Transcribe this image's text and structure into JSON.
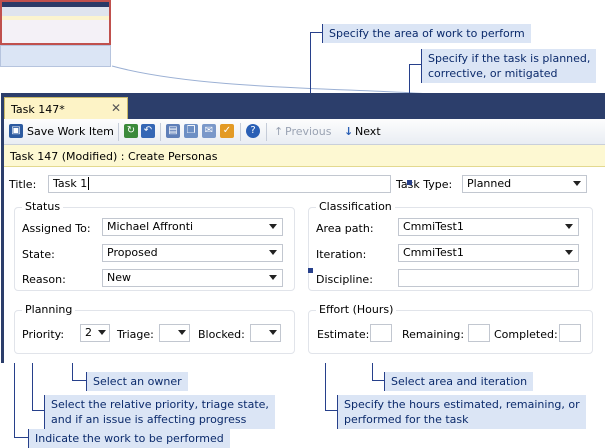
{
  "callouts": {
    "area_of_work": "Specify the area of work to perform",
    "task_type_1": "Specify if the task is planned,",
    "task_type_2": "corrective, or mitigated",
    "select_owner": "Select an owner",
    "priority_1": "Select the relative priority, triage state,",
    "priority_2": "and if an issue is affecting progress",
    "work_to_perform": "Indicate the work to be performed",
    "area_iteration": "Select area and iteration",
    "hours_1": "Specify the hours estimated, remaining, or",
    "hours_2": "performed for the task"
  },
  "tab": {
    "label": "Task 147*",
    "close": "✕"
  },
  "toolbar": {
    "save_label": "Save Work Item",
    "previous_label": "Previous",
    "next_label": "Next",
    "previous_arrow": "↑",
    "next_arrow": "↓"
  },
  "infobar": {
    "text": "Task 147 (Modified) : Create Personas"
  },
  "form": {
    "title_label": "Title:",
    "title_value": "Task 1",
    "task_type_label": "Task Type:",
    "task_type_value": "Planned",
    "status": {
      "heading": "Status",
      "assigned_label": "Assigned To:",
      "assigned_value": "Michael Affronti",
      "state_label": "State:",
      "state_value": "Proposed",
      "reason_label": "Reason:",
      "reason_value": "New"
    },
    "classification": {
      "heading": "Classification",
      "area_label": "Area path:",
      "area_value": "CmmiTest1",
      "iteration_label": "Iteration:",
      "iteration_value": "CmmiTest1",
      "discipline_label": "Discipline:",
      "discipline_value": ""
    },
    "planning": {
      "heading": "Planning",
      "priority_label": "Priority:",
      "priority_value": "2",
      "triage_label": "Triage:",
      "triage_value": "",
      "blocked_label": "Blocked:",
      "blocked_value": ""
    },
    "effort": {
      "heading": "Effort (Hours)",
      "estimate_label": "Estimate:",
      "estimate_value": "",
      "remaining_label": "Remaining:",
      "remaining_value": "",
      "completed_label": "Completed:",
      "completed_value": ""
    }
  },
  "colors": {
    "accent": "#27408b",
    "callout_bg": "#dbe5f5",
    "window_frame": "#2c3e6b",
    "info_bg": "#fdf8d2"
  }
}
